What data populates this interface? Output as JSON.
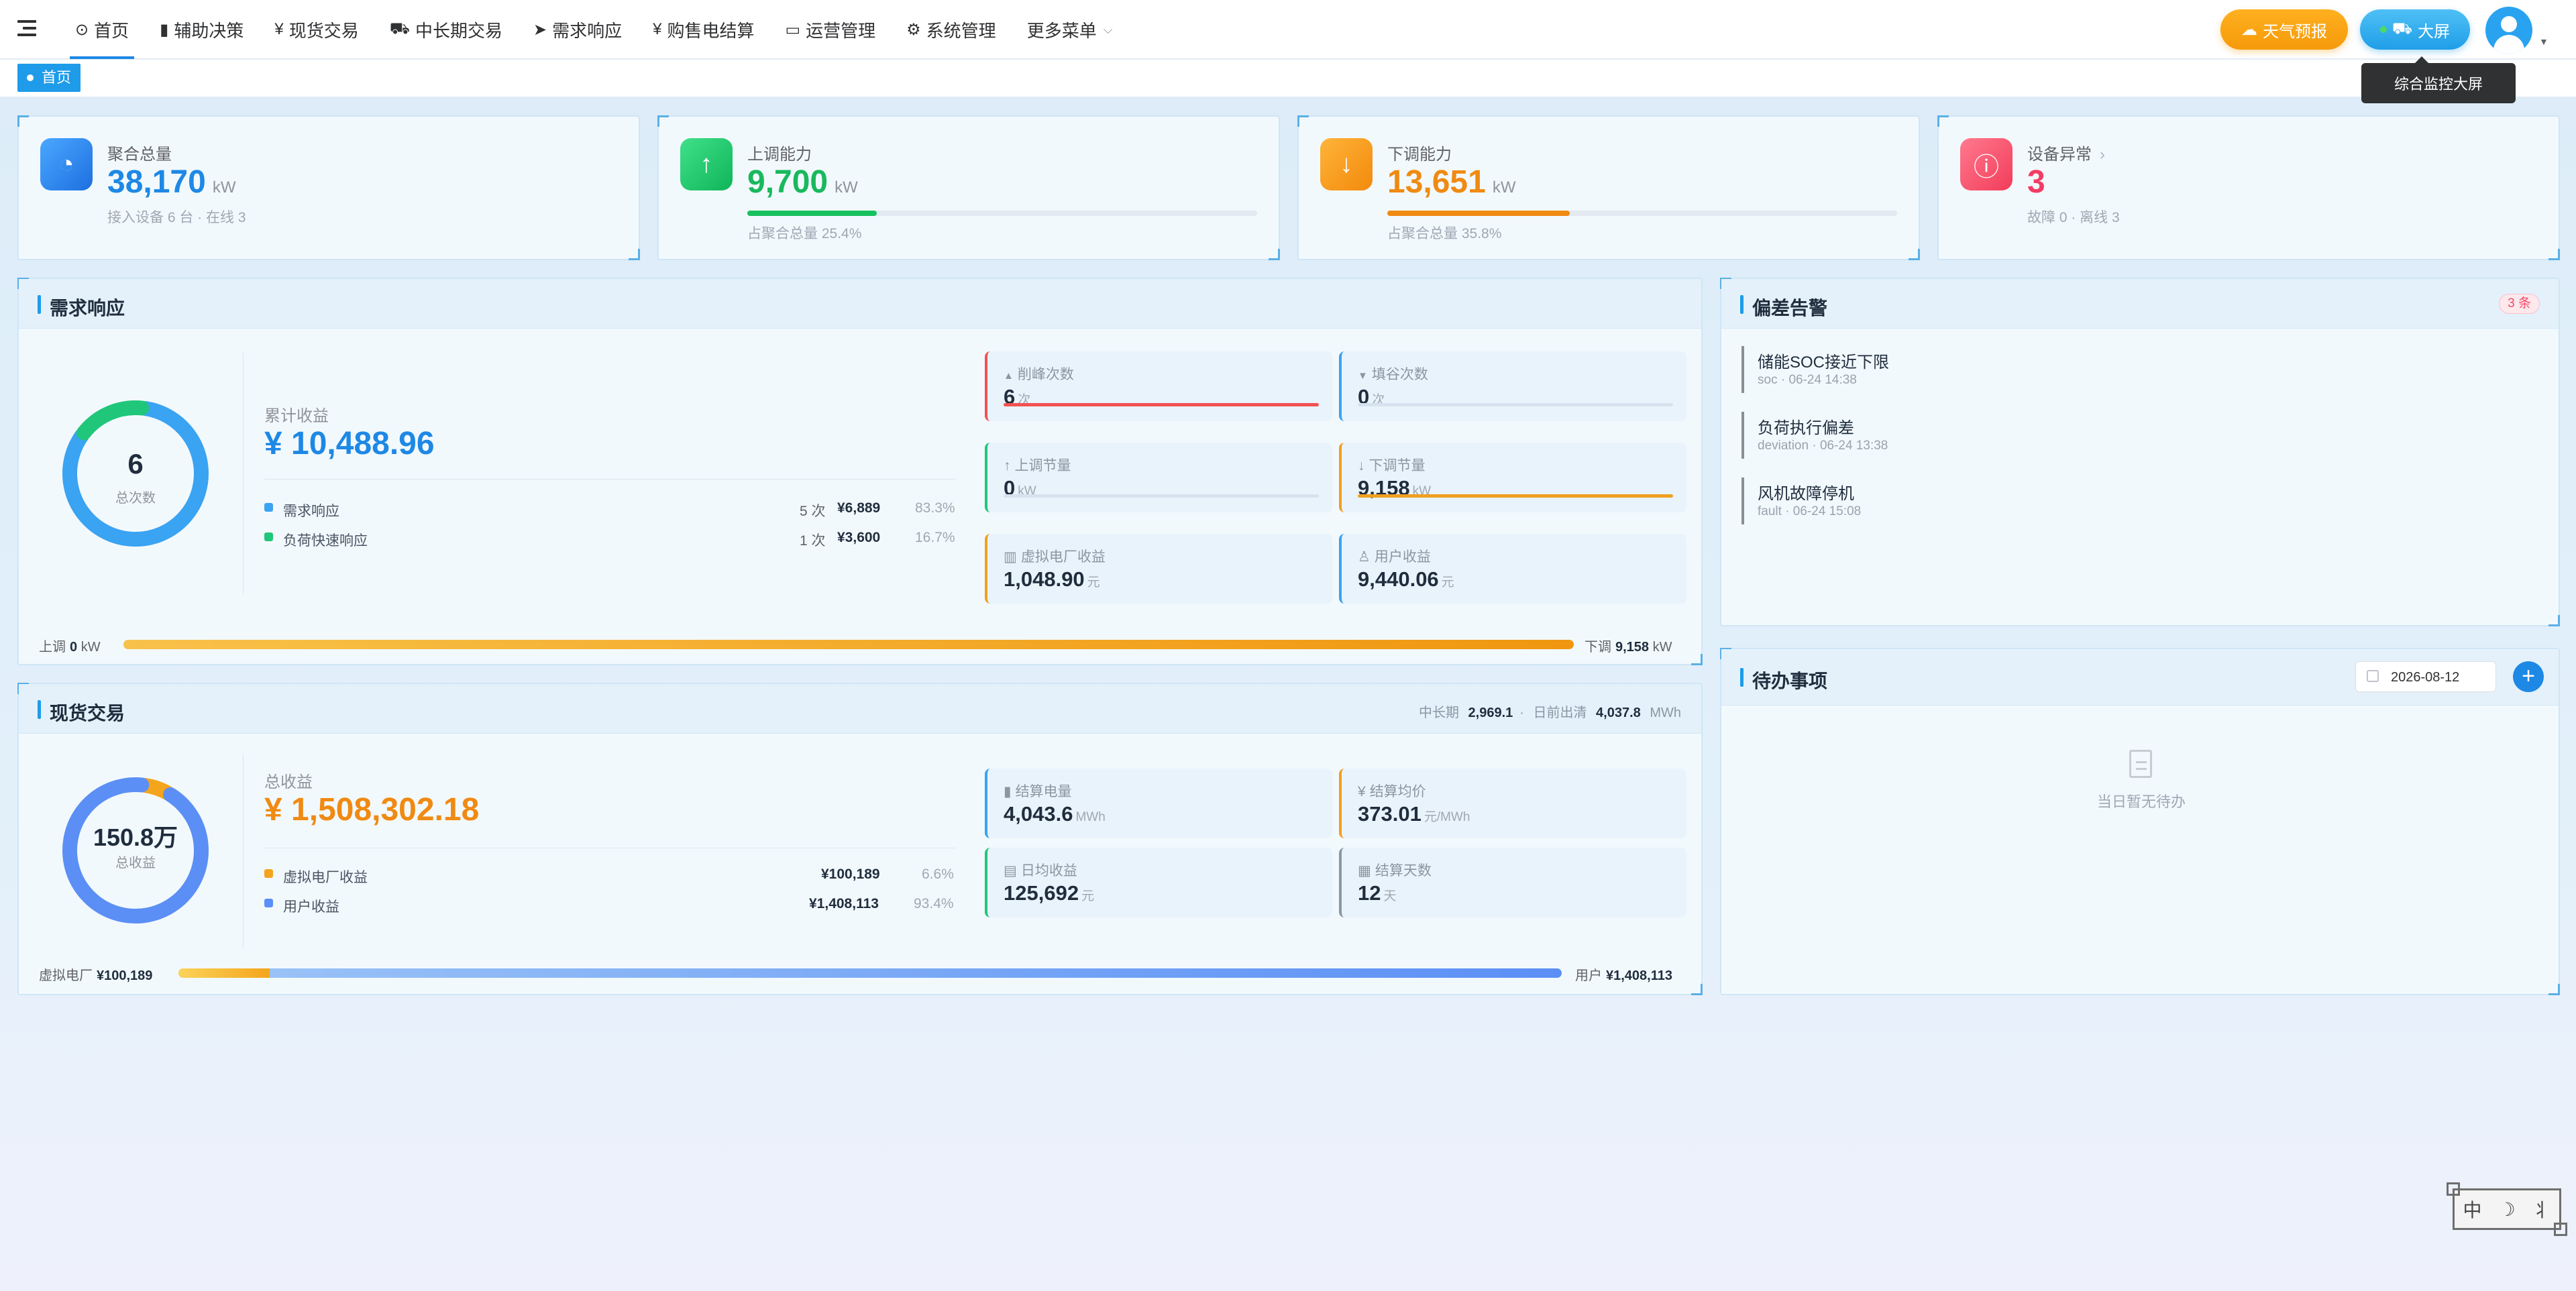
{
  "nav": {
    "items": [
      {
        "icon": "⊙",
        "label": "首页"
      },
      {
        "icon": "▮",
        "label": "辅助决策"
      },
      {
        "icon": "¥",
        "label": "现货交易"
      },
      {
        "icon": "⛟",
        "label": "中长期交易"
      },
      {
        "icon": "➤",
        "label": "需求响应"
      },
      {
        "icon": "¥",
        "label": "购售电结算"
      },
      {
        "icon": "▭",
        "label": "运营管理"
      },
      {
        "icon": "⚙",
        "label": "系统管理"
      },
      {
        "icon": "",
        "label": "更多菜单"
      }
    ],
    "weather_label": "天气预报",
    "screen_label": "大屏",
    "screen_tooltip": "综合监控大屏"
  },
  "tags": {
    "home": "首页"
  },
  "kpis": {
    "aggregate": {
      "title": "聚合总量",
      "value": "38,170",
      "unit": "kW",
      "sub": "接入设备 6 台 · 在线 3",
      "color": "#1e88e5"
    },
    "up": {
      "title": "上调能力",
      "value": "9,700",
      "unit": "kW",
      "sub": "占聚合总量 25.4%",
      "ratio": 0.254,
      "color": "#18b95d"
    },
    "down": {
      "title": "下调能力",
      "value": "13,651",
      "unit": "kW",
      "sub": "占聚合总量 35.8%",
      "ratio": 0.358,
      "color": "#f08a12"
    },
    "device": {
      "title": "设备异常",
      "value": "3",
      "sub": "故障 0 · 离线 3",
      "color": "#f23c64"
    }
  },
  "demand": {
    "title": "需求响应",
    "ring": {
      "value": "6",
      "label": "总次数",
      "shares": [
        0.833,
        0.167
      ],
      "colors": [
        "#3aa3f2",
        "#20c77a"
      ]
    },
    "summary_label": "累计收益",
    "summary_value": "¥ 10,488.96",
    "legend": [
      {
        "name": "需求响应",
        "count": "5 次",
        "amount": "¥6,889",
        "pct": "83.3%",
        "color": "#3aa3f2"
      },
      {
        "name": "负荷快速响应",
        "count": "1 次",
        "amount": "¥3,600",
        "pct": "16.7%",
        "color": "#20c77a"
      }
    ],
    "metrics": [
      {
        "icon": "▲",
        "label": "削峰次数",
        "value": "6",
        "unit": "次",
        "color": "#f25252",
        "ratio": 1.0
      },
      {
        "icon": "▼",
        "label": "填谷次数",
        "value": "0",
        "unit": "次",
        "color": "#3aa3f2",
        "ratio": 0.0
      },
      {
        "icon": "↑",
        "label": "上调节量",
        "value": "0",
        "unit": "kW",
        "color": "#20c77a",
        "ratio": 0.0
      },
      {
        "icon": "↓",
        "label": "下调节量",
        "value": "9,158",
        "unit": "kW",
        "color": "#f0a020",
        "ratio": 1.0
      },
      {
        "icon": "▥",
        "label": "虚拟电厂收益",
        "value": "1,048.90",
        "unit": "元",
        "color": "#f0a020"
      },
      {
        "icon": "♙",
        "label": "用户收益",
        "value": "9,440.06",
        "unit": "元",
        "color": "#3aa3f2"
      }
    ],
    "bar_left_label": "上调",
    "bar_left_value": "0",
    "bar_left_unit": "kW",
    "bar_right_label": "下调",
    "bar_right_value": "9,158",
    "bar_right_unit": "kW",
    "bar_down_share": 1.0
  },
  "spot": {
    "title": "现货交易",
    "header_info": {
      "mid_label": "中长期",
      "mid_value": "2,969.1",
      "day_label": "日前出清",
      "day_value": "4,037.8",
      "unit": "MWh"
    },
    "ring": {
      "value": "150.8万",
      "label": "总收益",
      "shares": [
        0.066,
        0.934
      ],
      "colors": [
        "#f4a51c",
        "#5b8ff5"
      ]
    },
    "summary_label": "总收益",
    "summary_value": "¥ 1,508,302.18",
    "legend": [
      {
        "name": "虚拟电厂收益",
        "amount": "¥100,189",
        "pct": "6.6%",
        "color": "#f4a51c"
      },
      {
        "name": "用户收益",
        "amount": "¥1,408,113",
        "pct": "93.4%",
        "color": "#5b8ff5"
      }
    ],
    "metrics": [
      {
        "icon": "▮",
        "label": "结算电量",
        "value": "4,043.6",
        "unit": "MWh",
        "color": "#3aa3f2"
      },
      {
        "icon": "¥",
        "label": "结算均价",
        "value": "373.01",
        "unit": "元/MWh",
        "color": "#f0a020"
      },
      {
        "icon": "▤",
        "label": "日均收益",
        "value": "125,692",
        "unit": "元",
        "color": "#20c77a"
      },
      {
        "icon": "▦",
        "label": "结算天数",
        "value": "12",
        "unit": "天",
        "color": "#8a96a3"
      }
    ],
    "bar_left_label": "虚拟电厂",
    "bar_left_value": "¥100,189",
    "bar_right_label": "用户",
    "bar_right_value": "¥1,408,113",
    "bar_vpp_share": 0.066
  },
  "alerts": {
    "title": "偏差告警",
    "count": "3 条",
    "items": [
      {
        "title": "储能SOC接近下限",
        "sub": "soc · 06-24 14:38"
      },
      {
        "title": "负荷执行偏差",
        "sub": "deviation · 06-24 13:38"
      },
      {
        "title": "风机故障停机",
        "sub": "fault · 06-24 15:08"
      }
    ]
  },
  "todo": {
    "title": "待办事项",
    "date": "2026-08-12",
    "add": "+",
    "empty": "当日暂无待办"
  },
  "widget": {
    "chars": [
      "中",
      "☽",
      "⺦"
    ]
  }
}
